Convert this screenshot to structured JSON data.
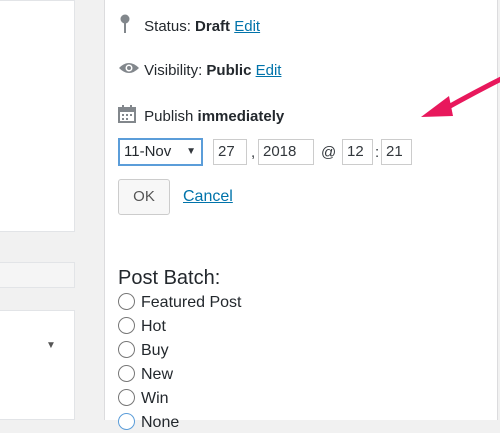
{
  "status": {
    "label": "Status:",
    "value": "Draft",
    "edit": "Edit"
  },
  "visibility": {
    "label": "Visibility:",
    "value": "Public",
    "edit": "Edit"
  },
  "publish": {
    "label": "Publish",
    "value": "immediately"
  },
  "date": {
    "month": "11-Nov",
    "day": "27",
    "year": "2018",
    "at": "@",
    "hour": "12",
    "minute": "21",
    "comma": ",",
    "colon": ":"
  },
  "buttons": {
    "ok": "OK",
    "cancel": "Cancel"
  },
  "post_batch": {
    "title": "Post Batch:",
    "options": [
      "Featured Post",
      "Hot",
      "Buy",
      "New",
      "Win",
      "None"
    ]
  },
  "colors": {
    "link": "#0073aa",
    "arrow": "#e8185c",
    "focus": "#5b9dd9"
  },
  "icons": [
    "pin-icon",
    "eye-icon",
    "calendar-icon",
    "chevron-down-icon"
  ]
}
